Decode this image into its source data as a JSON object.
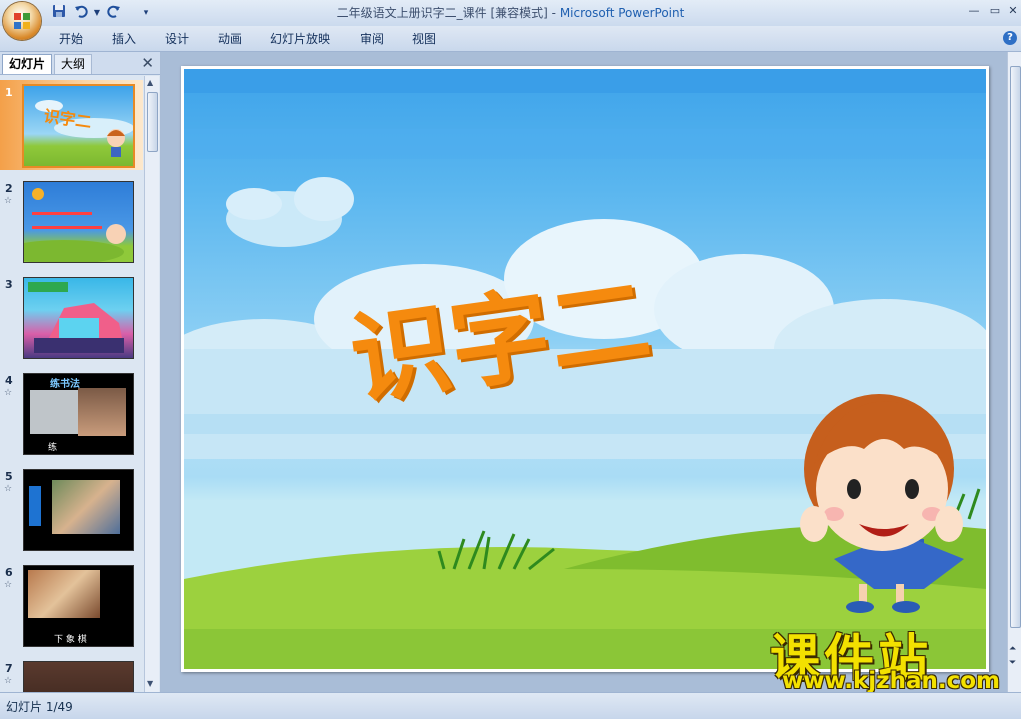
{
  "window": {
    "title_doc": "二年级语文上册识字二_课件 [兼容模式] - ",
    "title_app": "Microsoft PowerPoint",
    "minimize": "—",
    "restore": "▭",
    "close": "✕"
  },
  "quick_access": {
    "save_icon": "save-icon",
    "undo_icon": "undo-icon",
    "redo_icon": "redo-icon"
  },
  "ribbon": {
    "tabs": [
      "开始",
      "插入",
      "设计",
      "动画",
      "幻灯片放映",
      "审阅",
      "视图"
    ],
    "help": "?"
  },
  "panel": {
    "tab_slides": "幻灯片",
    "tab_outline": "大纲",
    "close": "✕",
    "slides": [
      {
        "num": "1",
        "anim": ""
      },
      {
        "num": "2",
        "anim": "☆"
      },
      {
        "num": "3",
        "anim": ""
      },
      {
        "num": "4",
        "anim": "☆"
      },
      {
        "num": "5",
        "anim": "☆"
      },
      {
        "num": "6",
        "anim": "☆"
      },
      {
        "num": "7",
        "anim": "☆"
      }
    ],
    "thumb4_title": "练书法",
    "thumb4_label": "练",
    "thumb6_label": "下 象 棋"
  },
  "slide": {
    "title": "识字二"
  },
  "watermark": {
    "cn": "课件站",
    "en": "www.kjzhan.com"
  },
  "status": {
    "text": "幻灯片 1/49"
  },
  "colors": {
    "title_orange": "#f58a0e",
    "sky": "#3da3ea",
    "grass": "#8fc93a",
    "selected": "#f4a049"
  }
}
